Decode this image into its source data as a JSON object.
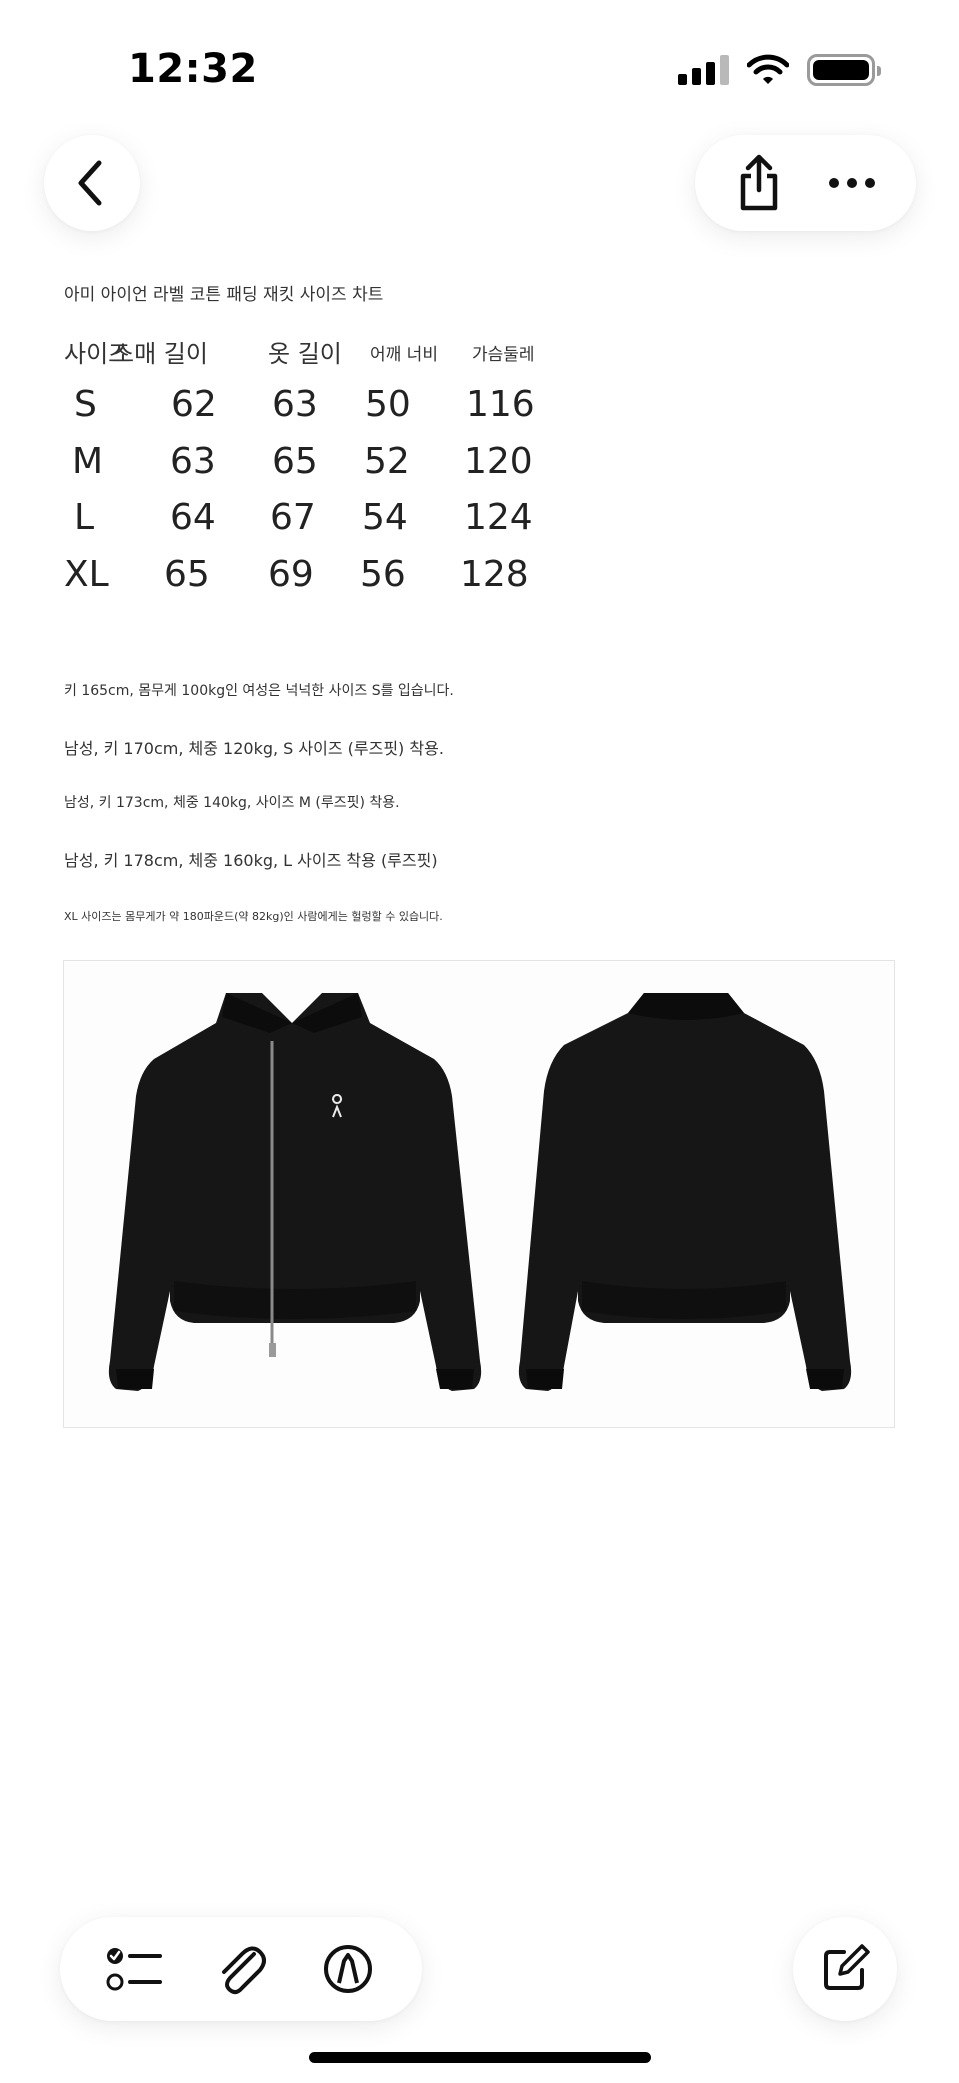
{
  "status_bar": {
    "time": "12:32"
  },
  "doc": {
    "title": "아미 아이언 라벨 코튼 패딩 재킷 사이즈 차트",
    "size_table": {
      "headers": [
        "사이즈",
        "소매 길이",
        "옷 길이",
        "어깨 너비",
        "가슴둘레"
      ],
      "rows": [
        [
          "S",
          "62",
          "63",
          "50",
          "116"
        ],
        [
          "M",
          "63",
          "65",
          "52",
          "120"
        ],
        [
          "L",
          "64",
          "67",
          "54",
          "124"
        ],
        [
          "XL",
          "65",
          "69",
          "56",
          "128"
        ]
      ]
    },
    "notes": [
      "키 165cm, 몸무게 100kg인 여성은 넉넉한 사이즈 S를 입습니다.",
      "남성, 키 170cm, 체중 120kg, S 사이즈 (루즈핏) 착용.",
      "남성, 키 173cm, 체중 140kg, 사이즈 M (루즈핏) 착용.",
      "남성, 키 178cm, 체중 160kg, L 사이즈 착용 (루즈핏)",
      "XL 사이즈는 몸무게가 약 180파운드(약 82kg)인 사람에게는 헐렁할 수 있습니다."
    ]
  },
  "icons": {
    "back": "chevron-left-icon",
    "share": "share-icon",
    "more": "ellipsis-icon",
    "checklist": "checklist-icon",
    "attach": "paperclip-icon",
    "markup": "pen-circle-icon",
    "compose": "compose-icon"
  }
}
